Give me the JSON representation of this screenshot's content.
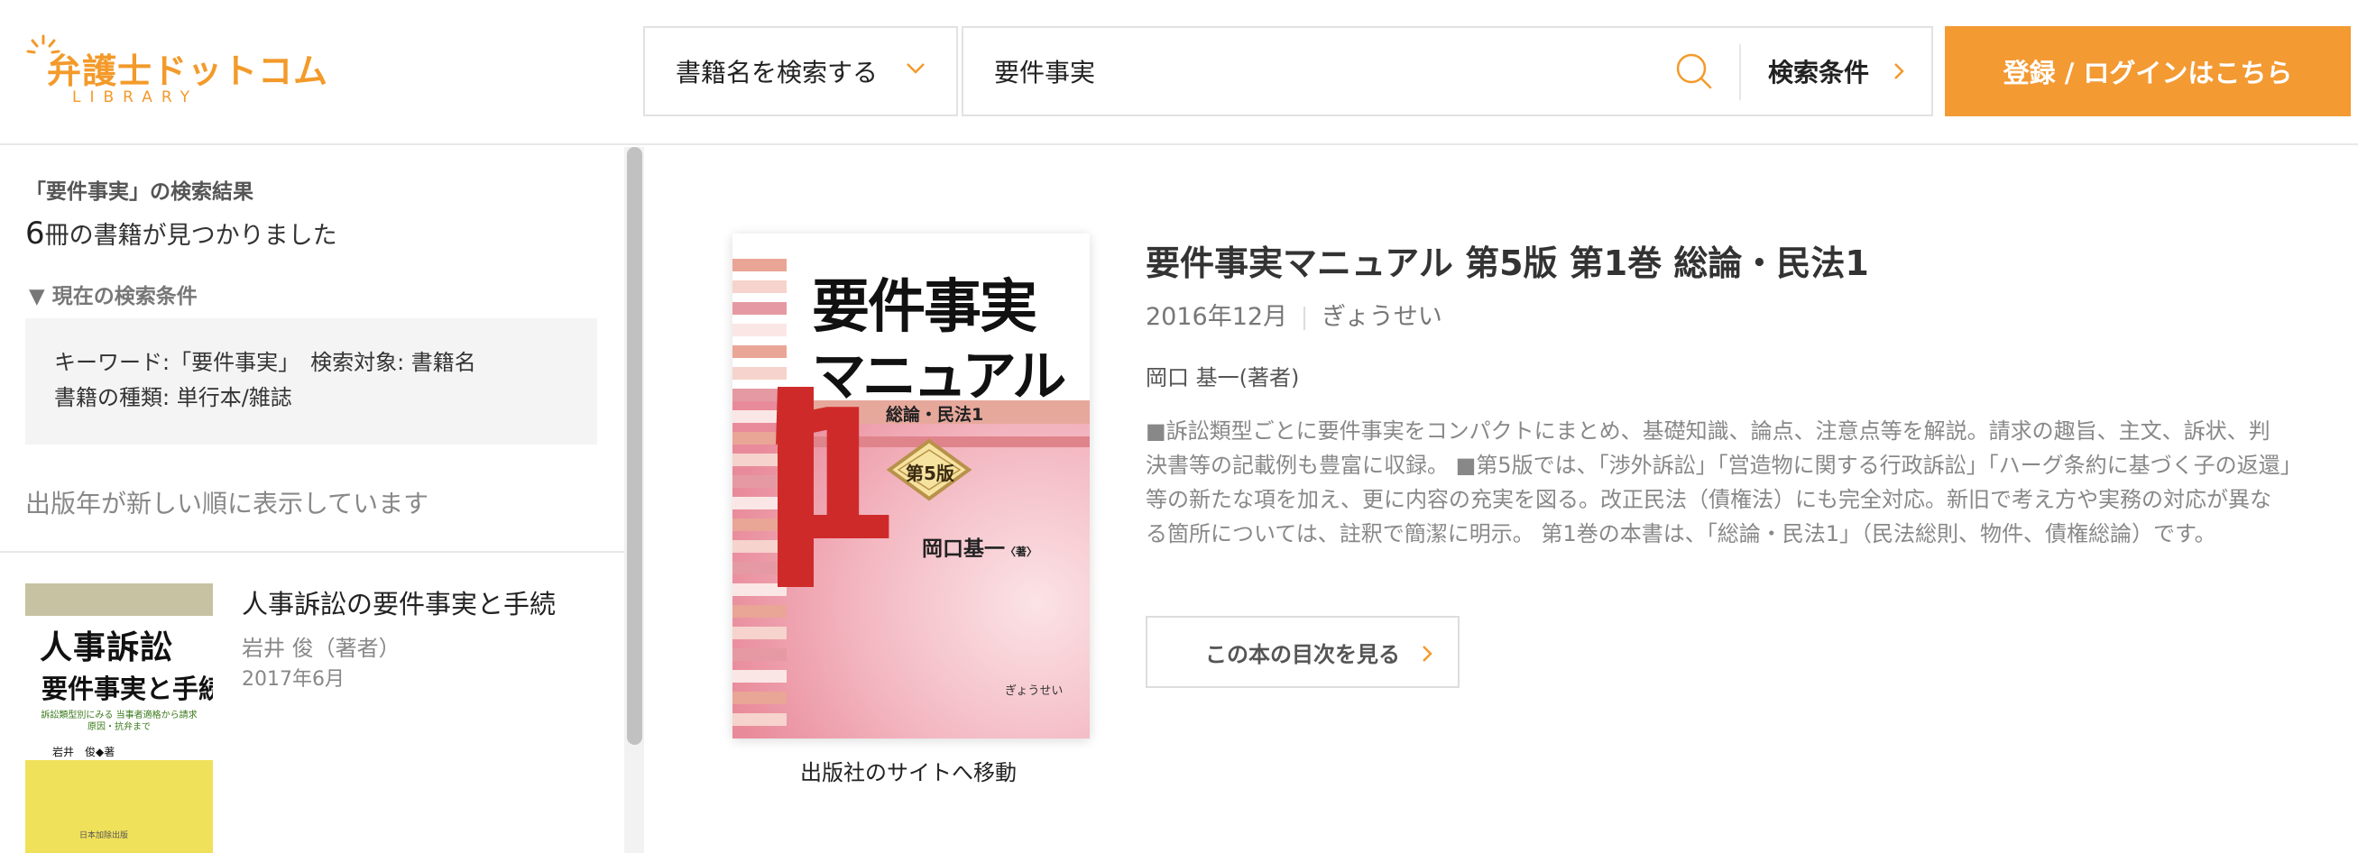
{
  "header": {
    "logo_text": "弁護士ドットコム",
    "logo_sub": "LIBRARY",
    "search_scope": "書籍名を検索する",
    "search_value": "要件事実",
    "conditions_label": "検索条件",
    "login_label": "登録 / ログインはこちら",
    "accent_color": "#f39a33"
  },
  "sidebar": {
    "heading": "「要件事実」の検索結果",
    "count_number": "6",
    "count_text": "冊の書籍が見つかりました",
    "current_conditions_label": "▼ 現在の検索条件",
    "condition_line1": "キーワード:「要件事実」　検索対象: 書籍名",
    "condition_line2": "書籍の種類: 単行本/雑誌",
    "sort_text": "出版年が新しい順に表示しています",
    "books": [
      {
        "title": "人事訴訟の要件事実と手続",
        "author": "岩井 俊（著者）",
        "date": "2017年6月",
        "cover_title1": "人事訴訟",
        "cover_title2": "要件事実と手続",
        "cover_sub": "訴訟類型別にみる 当事者適格から請求原因・抗弁まで",
        "cover_author": "岩井　俊◆著",
        "cover_publisher": "日本加除出版"
      }
    ]
  },
  "detail": {
    "title": "要件事実マニュアル 第5版 第1巻 総論・民法1",
    "date": "2016年12月",
    "publisher": "ぎょうせい",
    "author": "岡口 基一(著者)",
    "description": "■訴訟類型ごとに要件事実をコンパクトにまとめ、基礎知識、論点、注意点等を解説。請求の趣旨、主文、訴状、判決書等の記載例も豊富に収録。 ■第5版では、「渉外訴訟」「営造物に関する行政訴訟」「ハーグ条約に基づく子の返還」等の新たな項を加え、更に内容の充実を図る。改正民法（債権法）にも完全対応。新旧で考え方や実務の対応が異なる箇所については、註釈で簡潔に明示。 第1巻の本書は、「総論・民法1」（民法総則、物件、債権総論）です。",
    "toc_label": "この本の目次を見る",
    "publisher_link": "出版社のサイトへ移動",
    "cover": {
      "title1": "要件事実",
      "title2": "マニュアル",
      "volume_number": "1",
      "subtitle": "総論・民法1",
      "edition": "第5版",
      "author": "岡口基一",
      "author_suffix": "〈著〉",
      "publisher": "ぎょうせい"
    }
  }
}
